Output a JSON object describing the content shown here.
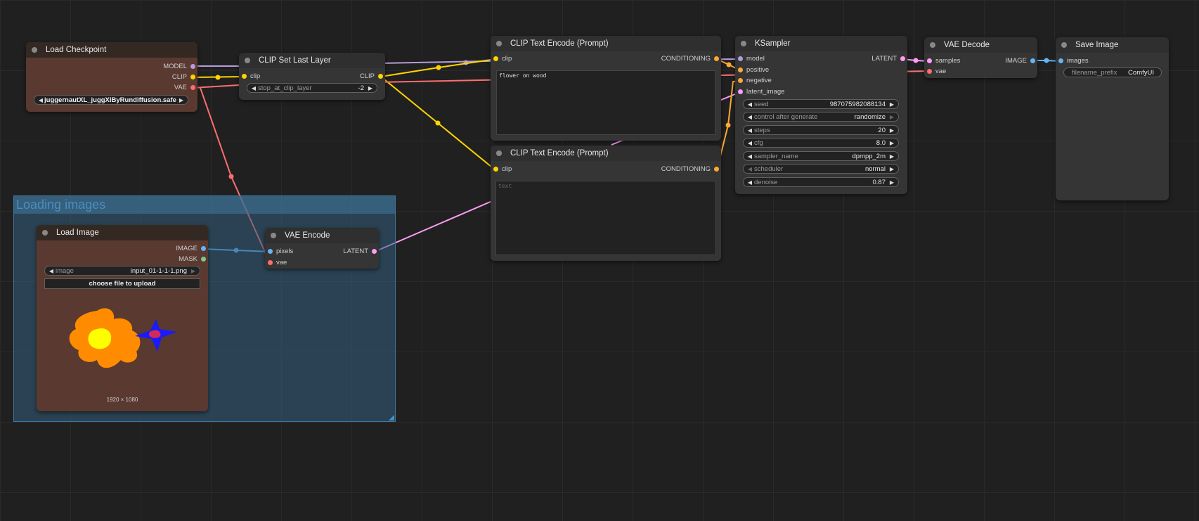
{
  "group": {
    "title": "Loading images"
  },
  "load_checkpoint": {
    "title": "Load Checkpoint",
    "outputs": [
      "MODEL",
      "CLIP",
      "VAE"
    ],
    "ckpt_name": "juggernautXL_juggXIByRundiffusion.safe ..."
  },
  "clip_set_last_layer": {
    "title": "CLIP Set Last Layer",
    "input": "clip",
    "output": "CLIP",
    "widget": {
      "name": "stop_at_clip_layer",
      "value": "-2"
    }
  },
  "clip_text_pos": {
    "title": "CLIP Text Encode (Prompt)",
    "input": "clip",
    "output": "CONDITIONING",
    "text": "flower on wood"
  },
  "clip_text_neg": {
    "title": "CLIP Text Encode (Prompt)",
    "input": "clip",
    "output": "CONDITIONING",
    "placeholder": "text"
  },
  "ksampler": {
    "title": "KSampler",
    "inputs": [
      "model",
      "positive",
      "negative",
      "latent_image"
    ],
    "output": "LATENT",
    "widgets": [
      {
        "name": "seed",
        "value": "987075982088134"
      },
      {
        "name": "control after generate",
        "value": "randomize"
      },
      {
        "name": "steps",
        "value": "20"
      },
      {
        "name": "cfg",
        "value": "8.0"
      },
      {
        "name": "sampler_name",
        "value": "dpmpp_2m"
      },
      {
        "name": "scheduler",
        "value": "normal"
      },
      {
        "name": "denoise",
        "value": "0.87"
      }
    ]
  },
  "vae_decode": {
    "title": "VAE Decode",
    "inputs": [
      "samples",
      "vae"
    ],
    "output": "IMAGE"
  },
  "save_image": {
    "title": "Save Image",
    "input": "images",
    "widget": {
      "name": "filename_prefix",
      "value": "ComfyUI"
    }
  },
  "load_image": {
    "title": "Load Image",
    "outputs": [
      "IMAGE",
      "MASK"
    ],
    "widget": {
      "name": "image",
      "value": "input_01-1-1-1.png"
    },
    "upload_label": "choose file to upload",
    "dimensions": "1920 × 1080"
  },
  "vae_encode": {
    "title": "VAE Encode",
    "inputs": [
      "pixels",
      "vae"
    ],
    "output": "LATENT"
  },
  "colors": {
    "model": "#b39ddb",
    "clip": "#ffd500",
    "vae": "#ff6e6e",
    "conditioning": "#ffa931",
    "latent": "#ff9cf9",
    "image": "#64b5f6",
    "mask": "#81c784"
  }
}
